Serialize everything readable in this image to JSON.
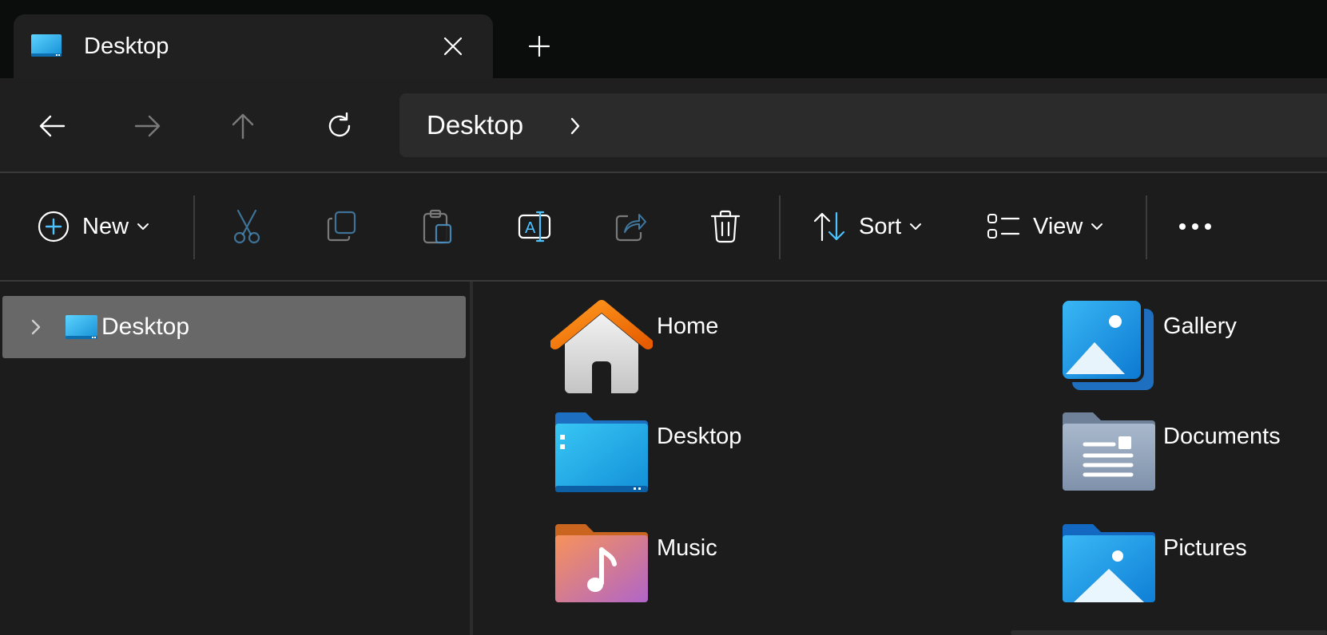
{
  "tab": {
    "title": "Desktop",
    "icon": "desktop-icon"
  },
  "address": {
    "crumbs": [
      "Desktop"
    ]
  },
  "toolbar": {
    "new_label": "New",
    "sort_label": "Sort",
    "view_label": "View",
    "icons": [
      "new-icon",
      "cut-icon",
      "copy-icon",
      "paste-icon",
      "rename-icon",
      "share-icon",
      "delete-icon",
      "sort-icon",
      "view-icon",
      "more-icon"
    ]
  },
  "navpane": {
    "items": [
      {
        "label": "Desktop",
        "icon": "desktop-icon"
      }
    ]
  },
  "content": {
    "items": [
      {
        "label": "Home",
        "icon": "home-icon"
      },
      {
        "label": "Gallery",
        "icon": "gallery-icon"
      },
      {
        "label": "Desktop",
        "icon": "desktop-folder-icon"
      },
      {
        "label": "Documents",
        "icon": "documents-folder-icon"
      },
      {
        "label": "Music",
        "icon": "music-folder-icon"
      },
      {
        "label": "Pictures",
        "icon": "pictures-folder-icon"
      }
    ]
  },
  "colors": {
    "accent": "#4cc2ff",
    "background": "#1c1c1c",
    "titlebar": "#0b0d0d",
    "selected_item": "#686868"
  }
}
